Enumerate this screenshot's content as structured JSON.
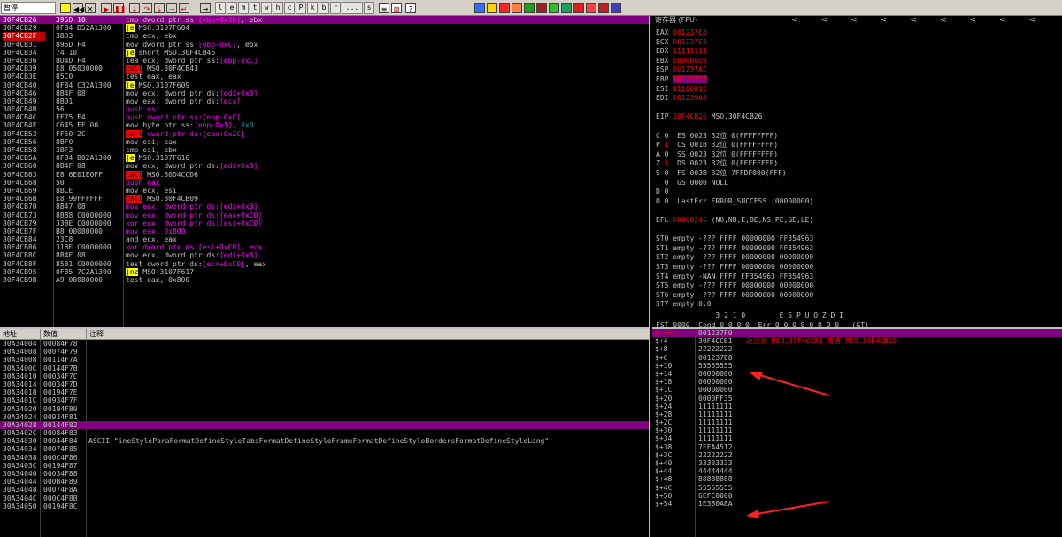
{
  "toolbar": {
    "status": "暂停",
    "buttons": [
      "l",
      "e",
      "m",
      "t",
      "w",
      "h",
      "c",
      "P",
      "k",
      "b",
      "r",
      "...",
      "s"
    ]
  },
  "disasm": [
    {
      "addr": "30F4CB26",
      "hex": "395D 10",
      "seg": [
        [
          "cmp dword ptr ss:",
          "kw"
        ],
        [
          "[ebp+0x10]",
          "push"
        ],
        [
          ", ebx",
          "kw"
        ]
      ],
      "sel": true
    },
    {
      "addr": "30F4CB29",
      "hex": "0F84 D52A1300",
      "seg": [
        [
          "je",
          "jmp"
        ],
        [
          " MSO.3107F604",
          "kw"
        ]
      ]
    },
    {
      "addr": "30F4CB2F",
      "hex": "3BD3",
      "seg": [
        [
          "cmp edx, ebx",
          "kw"
        ]
      ],
      "cur": true
    },
    {
      "addr": "30F4CB31",
      "hex": "895D F4",
      "seg": [
        [
          "mov dword ptr ss:",
          "kw"
        ],
        [
          "[ebp-0xC]",
          "push"
        ],
        [
          ", ebx",
          "kw"
        ]
      ]
    },
    {
      "addr": "30F4CB34",
      "hex": "74 10",
      "seg": [
        [
          "je",
          "jmp"
        ],
        [
          " short MSO.30F4CB46",
          "kw"
        ]
      ]
    },
    {
      "addr": "30F4CB36",
      "hex": "8D4D F4",
      "seg": [
        [
          "lea ecx, dword ptr ss:",
          "kw"
        ],
        [
          "[ebp-0xC]",
          "push"
        ]
      ]
    },
    {
      "addr": "30F4CB39",
      "hex": "E8 05030000",
      "seg": [
        [
          "call",
          "call"
        ],
        [
          " MSO.30F4CB43",
          "kw"
        ]
      ]
    },
    {
      "addr": "30F4CB3E",
      "hex": "85C0",
      "seg": [
        [
          "test eax, eax",
          "kw"
        ]
      ]
    },
    {
      "addr": "30F4CB40",
      "hex": "0F84 C32A1300",
      "seg": [
        [
          "je",
          "jmp"
        ],
        [
          " MSO.3107F609",
          "kw"
        ]
      ]
    },
    {
      "addr": "30F4CB46",
      "hex": "8B4F 08",
      "seg": [
        [
          "mov ecx, dword ptr ds:",
          "kw"
        ],
        [
          "[edi+0x8]",
          "push"
        ]
      ]
    },
    {
      "addr": "30F4CB49",
      "hex": "8B01",
      "seg": [
        [
          "mov eax, dword ptr ds:",
          "kw"
        ],
        [
          "[ecx]",
          "push"
        ]
      ]
    },
    {
      "addr": "30F4CB4B",
      "hex": "56",
      "seg": [
        [
          "push esi",
          "push"
        ]
      ]
    },
    {
      "addr": "30F4CB4C",
      "hex": "FF75 F4",
      "seg": [
        [
          "push dword ptr ss:",
          "push"
        ],
        [
          "[ebp-0xC]",
          "push"
        ]
      ]
    },
    {
      "addr": "30F4CB4F",
      "hex": "C645 FF 00",
      "seg": [
        [
          "mov byte ptr ss:",
          "kw"
        ],
        [
          "[ebp-0x1]",
          "push"
        ],
        [
          ", 0x0",
          "num"
        ]
      ]
    },
    {
      "addr": "30F4CB53",
      "hex": "FF50 2C",
      "seg": [
        [
          "call",
          "call"
        ],
        [
          " dword ptr ds:",
          "push"
        ],
        [
          "[eax+0x2C]",
          "push"
        ]
      ]
    },
    {
      "addr": "30F4CB56",
      "hex": "8BF0",
      "seg": [
        [
          "mov esi, eax",
          "kw"
        ]
      ]
    },
    {
      "addr": "30F4CB58",
      "hex": "3BF3",
      "seg": [
        [
          "cmp esi, ebx",
          "kw"
        ]
      ]
    },
    {
      "addr": "30F4CB5A",
      "hex": "0F84 B02A1300",
      "seg": [
        [
          "je",
          "jmp"
        ],
        [
          " MSO.3107F610",
          "kw"
        ]
      ]
    },
    {
      "addr": "30F4CB60",
      "hex": "8B4F 08",
      "seg": [
        [
          "mov ecx, dword ptr ds:",
          "kw"
        ],
        [
          "[edi+0x8]",
          "push"
        ]
      ]
    },
    {
      "addr": "30F4CB63",
      "hex": "E8 6E01E0FF",
      "seg": [
        [
          "call",
          "call"
        ],
        [
          " MSO.30D4CCD6",
          "kw"
        ]
      ]
    },
    {
      "addr": "30F4CB68",
      "hex": "50",
      "seg": [
        [
          "push eax",
          "push"
        ]
      ]
    },
    {
      "addr": "30F4CB69",
      "hex": "8BCE",
      "seg": [
        [
          "mov ecx, esi",
          "kw"
        ]
      ]
    },
    {
      "addr": "30F4CB6B",
      "hex": "E8 99FFFFFF",
      "seg": [
        [
          "call",
          "call"
        ],
        [
          " MSO.30F4CB09",
          "kw"
        ]
      ]
    },
    {
      "addr": "30F4CB70",
      "hex": "8B47 08",
      "seg": [
        [
          "mov eax, dword ptr ds:",
          "push"
        ],
        [
          "[edi+0x8]",
          "push"
        ]
      ]
    },
    {
      "addr": "30F4CB73",
      "hex": "8B88 C0000000",
      "seg": [
        [
          "mov ecx, dword ptr ds:",
          "push"
        ],
        [
          "[eax+0xC0]",
          "push"
        ]
      ]
    },
    {
      "addr": "30F4CB79",
      "hex": "338E C0000000",
      "seg": [
        [
          "xor ecx, dword ptr ds:",
          "push"
        ],
        [
          "[esi+0xC0]",
          "push"
        ]
      ]
    },
    {
      "addr": "30F4CB7F",
      "hex": "B8 00080000",
      "seg": [
        [
          "mov eax, 0x800",
          "push"
        ]
      ]
    },
    {
      "addr": "30F4CB84",
      "hex": "23C8",
      "seg": [
        [
          "and ecx, eax",
          "kw"
        ]
      ]
    },
    {
      "addr": "30F4CB86",
      "hex": "318E C0000000",
      "seg": [
        [
          "xor dword ptr ds:",
          "push"
        ],
        [
          "[esi+0xC0]",
          "push"
        ],
        [
          ", ecx",
          "push"
        ]
      ]
    },
    {
      "addr": "30F4CB8C",
      "hex": "8B4F 08",
      "seg": [
        [
          "mov ecx, dword ptr ds:",
          "kw"
        ],
        [
          "[edi+0x8]",
          "push"
        ]
      ]
    },
    {
      "addr": "30F4CB8F",
      "hex": "8581 C0000000",
      "seg": [
        [
          "test dword ptr ds:",
          "kw"
        ],
        [
          "[ecx+0xC0]",
          "push"
        ],
        [
          ", eax",
          "kw"
        ]
      ]
    },
    {
      "addr": "30F4CB95",
      "hex": "0F85 7C2A1300",
      "seg": [
        [
          "jnz",
          "jmp"
        ],
        [
          " MSO.3107F617",
          "kw"
        ]
      ]
    },
    {
      "addr": "30F4CB9B",
      "hex": "A9 00080000",
      "seg": [
        [
          "test eax, 0x800",
          "kw"
        ]
      ]
    }
  ],
  "regs": {
    "title": "寄存器 (FPU)",
    "arrows": [
      "<",
      "<",
      "<",
      "<",
      "<",
      "<",
      "<",
      "<",
      "<"
    ],
    "gp": [
      [
        "EAX",
        "001237E8",
        false
      ],
      [
        "ECX",
        "001237E8",
        false
      ],
      [
        "EDX",
        "11111111",
        false
      ],
      [
        "EBX",
        "00000000",
        false
      ],
      [
        "ESP",
        "001237AC",
        false
      ],
      [
        "EBP",
        "001237E8",
        true
      ],
      [
        "ESI",
        "0118081C",
        false
      ],
      [
        "EDI",
        "001239A8",
        false
      ]
    ],
    "eip": [
      "EIP",
      "30F4CB26",
      "MSO.30F4CB26"
    ],
    "flags": [
      [
        "C",
        "0",
        "ES 0023 32位 0(FFFFFFFF)"
      ],
      [
        "P",
        "1",
        "CS 001B 32位 0(FFFFFFFF)"
      ],
      [
        "A",
        "0",
        "SS 0023 32位 0(FFFFFFFF)"
      ],
      [
        "Z",
        "1",
        "DS 0023 32位 0(FFFFFFFF)"
      ],
      [
        "S",
        "0",
        "FS 003B 32位 7FFDF000(FFF)"
      ],
      [
        "T",
        "0",
        "GS 0000 NULL"
      ],
      [
        "D",
        "0",
        ""
      ],
      [
        "O",
        "0",
        "LastErr ERROR_SUCCESS (00000000)"
      ]
    ],
    "efl": [
      "EFL",
      "00000246",
      "(NO,NB,E,BE,NS,PE,GE,LE)"
    ],
    "st": [
      "ST0 empty -??? FFFF 00000000 FF354963",
      "ST1 empty -??? FFFF 00000000 FF354963",
      "ST2 empty -??? FFFF 00000000 00000000",
      "ST3 empty -??? FFFF 00000000 00000000",
      "ST4 empty -NAN FFFF FF354963 FF354963",
      "ST5 empty -??? FFFF 00000000 00000000",
      "ST6 empty -??? FFFF 00000000 00000000",
      "ST7 empty 0.0"
    ],
    "fpu": [
      "              3 2 1 0        E S P U O Z D I",
      "FST 0000  Cond 0 0 0 0  Err 0 0 0 0 0 0 0 0   (GT)",
      "FCW 037F  Prec NEAR,64  掩码     1 1 1 1 1 1"
    ]
  },
  "dump": {
    "headers": [
      "地址",
      "数值",
      "注释"
    ],
    "rows": [
      [
        "30A34004",
        "00084F78",
        ""
      ],
      [
        "30A34008",
        "00074F79",
        ""
      ],
      [
        "30A34008",
        "00114F7A",
        ""
      ],
      [
        "30A3400C",
        "00144F7B",
        ""
      ],
      [
        "30A34010",
        "00034F7C",
        ""
      ],
      [
        "30A34014",
        "00034F7D",
        ""
      ],
      [
        "30A34018",
        "00194F7E",
        ""
      ],
      [
        "30A3401C",
        "00934F7F",
        ""
      ],
      [
        "30A34020",
        "00194F80",
        ""
      ],
      [
        "30A34024",
        "00934F81",
        ""
      ],
      [
        "30A34028",
        "00144F82",
        ""
      ],
      [
        "30A3402C",
        "00084F83",
        ""
      ],
      [
        "30A34030",
        "00044F84",
        "ASCII \"ineStyleParaFormatDefineStyleTabsFormatDefineStyleFrameFormatDefineStyleBordersFormatDefineStyleLang\""
      ],
      [
        "30A34034",
        "00074F85",
        ""
      ],
      [
        "30A34038",
        "000C4F86",
        ""
      ],
      [
        "30A3403C",
        "00194F87",
        ""
      ],
      [
        "30A34040",
        "00034F88",
        ""
      ],
      [
        "30A34044",
        "000B4F89",
        ""
      ],
      [
        "30A34048",
        "00074F8A",
        ""
      ],
      [
        "30A3404C",
        "000C4F8B",
        ""
      ],
      [
        "30A34050",
        "00194F8C",
        ""
      ]
    ],
    "selected": 10
  },
  "stack": {
    "rows": [
      [
        "$ ==>",
        "001237F0",
        ""
      ],
      [
        "$+4",
        "30F4CCB1",
        "返回到 MSO.30F4CCB1 来自 MSO.30F4CB1D"
      ],
      [
        "$+8",
        "22222222",
        ""
      ],
      [
        "$+C",
        "001237E8",
        ""
      ],
      [
        "$+10",
        "55555555",
        ""
      ],
      [
        "$+14",
        "00000000",
        ""
      ],
      [
        "$+18",
        "00000000",
        ""
      ],
      [
        "$+1C",
        "00000000",
        ""
      ],
      [
        "$+20",
        "0000FF35",
        ""
      ],
      [
        "$+24",
        "11111111",
        ""
      ],
      [
        "$+28",
        "11111111",
        ""
      ],
      [
        "$+2C",
        "11111111",
        ""
      ],
      [
        "$+30",
        "11111111",
        ""
      ],
      [
        "$+34",
        "11111111",
        ""
      ],
      [
        "$+38",
        "7FFA4512",
        ""
      ],
      [
        "$+3C",
        "22222222",
        ""
      ],
      [
        "$+40",
        "33333333",
        ""
      ],
      [
        "$+44",
        "44444444",
        ""
      ],
      [
        "$+48",
        "88888888",
        ""
      ],
      [
        "$+4C",
        "55555555",
        ""
      ],
      [
        "$+50",
        "6EFC0000",
        ""
      ],
      [
        "$+54",
        "1E380A8A",
        ""
      ]
    ]
  }
}
